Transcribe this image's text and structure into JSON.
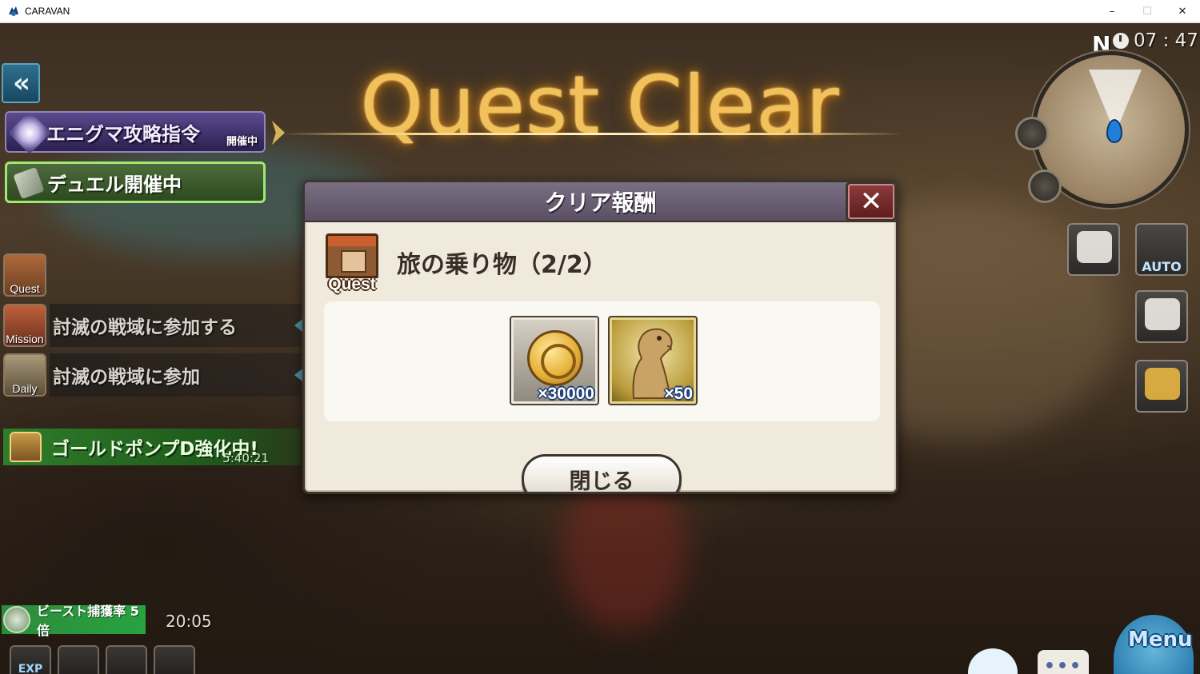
{
  "window": {
    "title": "CARAVAN",
    "controls": {
      "minimize": "–",
      "maximize": "☐",
      "close": "✕"
    }
  },
  "hud_left": {
    "back_glyph": "«",
    "enigma_banner": {
      "label": "エニグマ攻略指令",
      "status": "開催中"
    },
    "duel_banner": {
      "label": "デュエル開催中"
    },
    "quest_rows": [
      {
        "icon_label": "Quest",
        "text": ""
      },
      {
        "icon_label": "Mission",
        "text": "討滅の戦域に参加する"
      },
      {
        "icon_label": "Daily",
        "text": "討滅の戦域に参加"
      }
    ],
    "gold_pump": {
      "label": "ゴールドポンプD強化中!",
      "timer": "5:40:21"
    },
    "beast": {
      "label": "ビースト捕獲率 5倍",
      "time": "20:05"
    },
    "bottom_icons": [
      "EXP",
      "",
      "",
      ""
    ]
  },
  "title_banner": "Quest Clear",
  "modal": {
    "header": "クリア報酬",
    "close_glyph": "✕",
    "quest_icon_label": "Quest",
    "quest_title": "旅の乗り物（2/2）",
    "rewards": [
      {
        "icon": "gold-coin-icon",
        "quantity": "×30000"
      },
      {
        "icon": "camel-icon",
        "quantity": "×50"
      }
    ],
    "close_button": "閉じる"
  },
  "hud_right": {
    "compass": "N",
    "clock": "07 : 47",
    "buttons": {
      "auto": "AUTO"
    },
    "menu_label": "Menu",
    "chat_glyph": "•••"
  }
}
